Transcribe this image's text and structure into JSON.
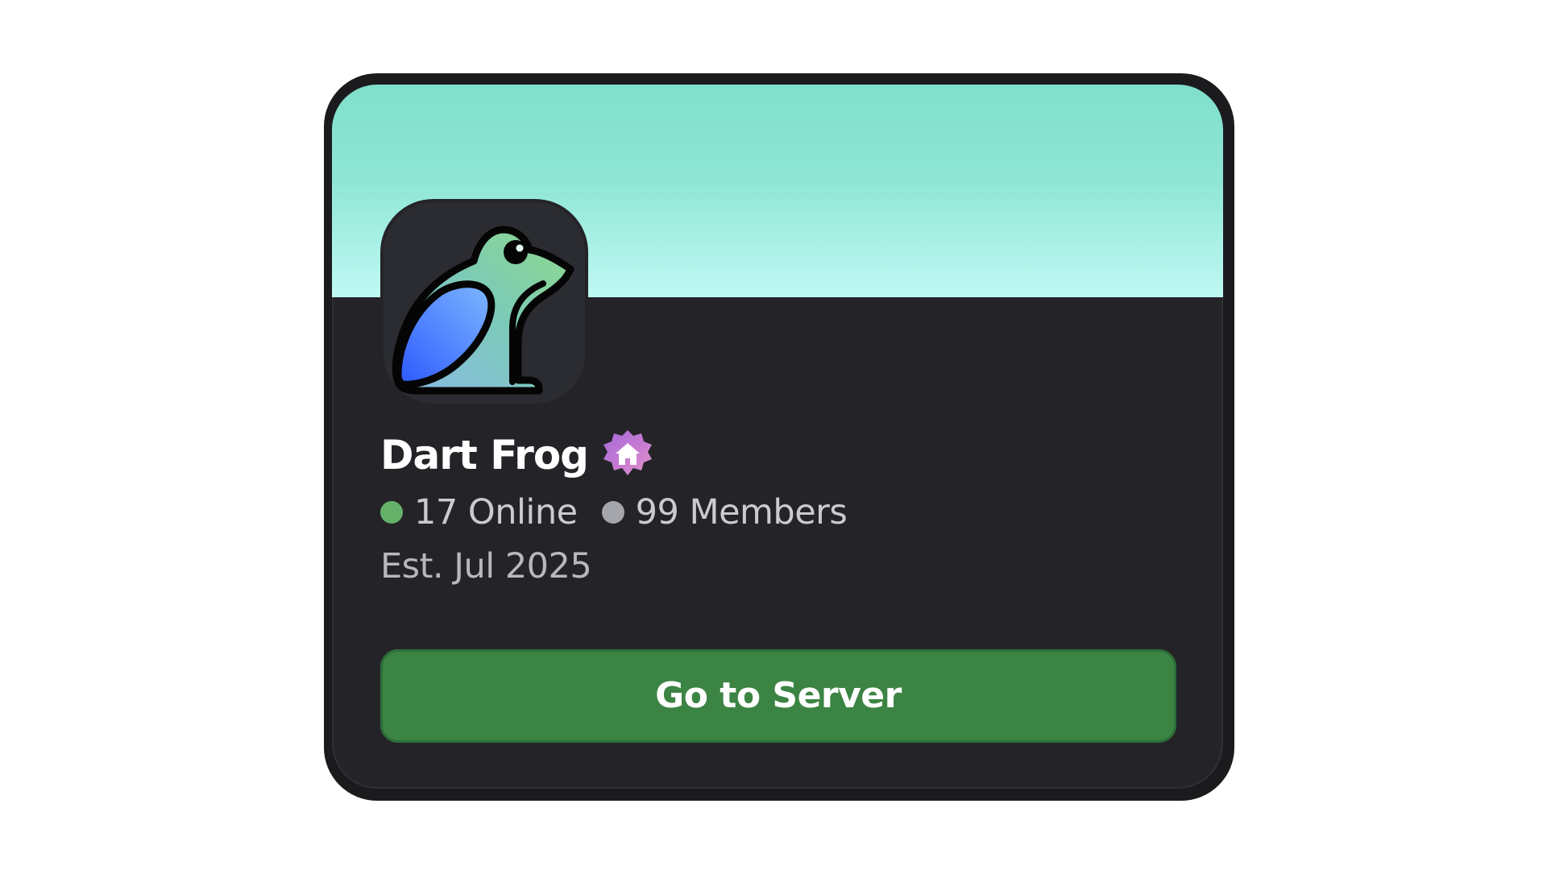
{
  "server": {
    "name": "Dart Frog",
    "online_text": "17 Online",
    "members_text": "99 Members",
    "established_text": "Est. Jul 2025"
  },
  "actions": {
    "go_to_server_label": "Go to Server"
  },
  "icons": {
    "server_icon": "dart-frog-logo",
    "badge_icon": "house-badge-icon"
  },
  "colors": {
    "banner_top": "#7fdfca",
    "banner_bottom": "#bff9f4",
    "card_background": "#242428",
    "online_dot": "#65b169",
    "members_dot": "#a5a6ab",
    "button_background": "#3c8444",
    "badge_pink": "#e497c8",
    "badge_purple": "#a46ad8"
  }
}
